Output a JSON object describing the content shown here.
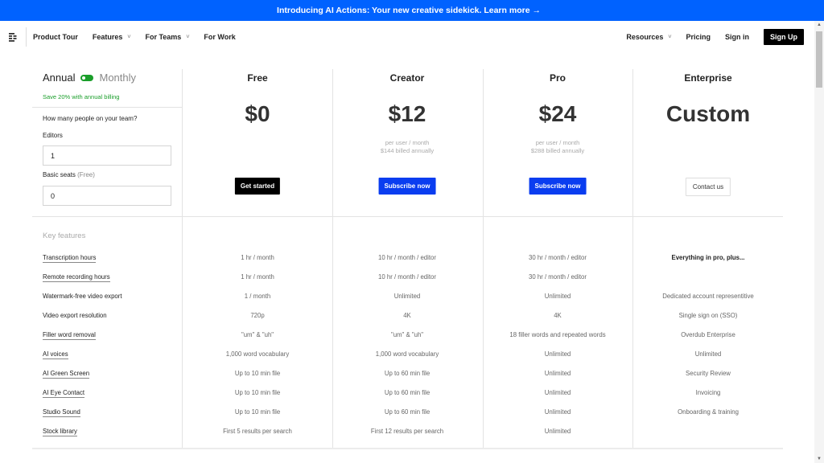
{
  "banner": {
    "text": "Introducing AI Actions: Your new creative sidekick. Learn more →"
  },
  "nav": {
    "left": [
      {
        "label": "Product Tour",
        "dropdown": false
      },
      {
        "label": "Features",
        "dropdown": true
      },
      {
        "label": "For Teams",
        "dropdown": true
      },
      {
        "label": "For Work",
        "dropdown": false
      }
    ],
    "right": [
      {
        "label": "Resources",
        "dropdown": true
      },
      {
        "label": "Pricing",
        "dropdown": false
      },
      {
        "label": "Sign in",
        "dropdown": false
      }
    ],
    "signup_label": "Sign Up",
    "chevron": "˅"
  },
  "billing": {
    "annual_label": "Annual",
    "monthly_label": "Monthly",
    "selected": "Annual",
    "save_text": "Save 20% with annual billing",
    "accent": "#1a9e2a"
  },
  "team": {
    "question": "How many people on your team?",
    "editors_label": "Editors",
    "editors_value": "1",
    "basic_label": "Basic seats",
    "basic_note": "(Free)",
    "basic_value": "0"
  },
  "plans": [
    {
      "name": "Free",
      "price": "$0",
      "per": "",
      "billed": "",
      "cta": "Get started"
    },
    {
      "name": "Creator",
      "price": "$12",
      "per": "per user / month",
      "billed": "$144 billed annually",
      "cta": "Subscribe now"
    },
    {
      "name": "Pro",
      "price": "$24",
      "per": "per user / month",
      "billed": "$288 billed annually",
      "cta": "Subscribe now"
    },
    {
      "name": "Enterprise",
      "price": "Custom",
      "per": "",
      "billed": "",
      "cta": "Contact us"
    }
  ],
  "features": {
    "heading": "Key features",
    "rows": [
      {
        "label": "Transcription hours",
        "link": true,
        "values": [
          "1 hr / month",
          "10 hr / month / editor",
          "30 hr / month / editor",
          "Everything in pro, plus..."
        ]
      },
      {
        "label": "Remote recording hours",
        "link": true,
        "values": [
          "1 hr / month",
          "10 hr / month / editor",
          "30 hr / month / editor",
          ""
        ]
      },
      {
        "label": "Watermark-free video export",
        "link": false,
        "values": [
          "1 / month",
          "Unlimited",
          "Unlimited",
          "Dedicated account representitive"
        ]
      },
      {
        "label": "Video export resolution",
        "link": false,
        "values": [
          "720p",
          "4K",
          "4K",
          "Single sign on (SSO)"
        ]
      },
      {
        "label": "Filler word removal",
        "link": true,
        "values": [
          "\"um\" & \"uh\"",
          "\"um\" & \"uh\"",
          "18 filler words and repeated words",
          "Overdub Enterprise"
        ]
      },
      {
        "label": "AI voices",
        "link": true,
        "values": [
          "1,000 word vocabulary",
          "1,000 word vocabulary",
          "Unlimited",
          "Unlimited"
        ]
      },
      {
        "label": "AI Green Screen",
        "link": true,
        "values": [
          "Up to 10 min file",
          "Up to 60 min file",
          "Unlimited",
          "Security Review"
        ]
      },
      {
        "label": "AI Eye Contact",
        "link": true,
        "values": [
          "Up to 10 min file",
          "Up to 60 min file",
          "Unlimited",
          "Invoicing"
        ]
      },
      {
        "label": "Studio Sound",
        "link": true,
        "values": [
          "Up to 10 min file",
          "Up to 60 min file",
          "Unlimited",
          "Onboarding & training"
        ]
      },
      {
        "label": "Stock library",
        "link": true,
        "values": [
          "First 5 results per search",
          "First 12 results per search",
          "Unlimited",
          ""
        ]
      }
    ]
  },
  "scrollbar": {
    "up": "▲",
    "down": "▼"
  }
}
